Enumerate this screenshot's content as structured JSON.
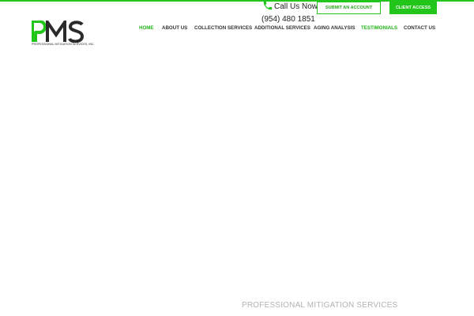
{
  "brand": {
    "logo_text": "PMS",
    "logo_subtitle": "Professional Mitigation Services, Inc.",
    "accent_color": "#22c51a"
  },
  "header": {
    "call_label": "Call Us Now",
    "phone_number": "(954) 480 1851",
    "phone_icon": "phone-icon",
    "submit_account_label": "SUBMIT AN ACCOUNT",
    "client_access_label": "CLIENT ACCESS"
  },
  "nav": {
    "items": [
      {
        "label": "HOME",
        "active": true
      },
      {
        "label": "ABOUT US"
      },
      {
        "label": "COLLECTION SERVICES"
      },
      {
        "label": "ADDITIONAL SERVICES"
      },
      {
        "label": "AGING ANALYSIS"
      },
      {
        "label": "TESTIMONIALS",
        "highlight": true
      },
      {
        "label": "CONTACT US"
      }
    ]
  },
  "hero": {
    "caption": "PROFESSIONAL MITIGATION SERVICES"
  }
}
